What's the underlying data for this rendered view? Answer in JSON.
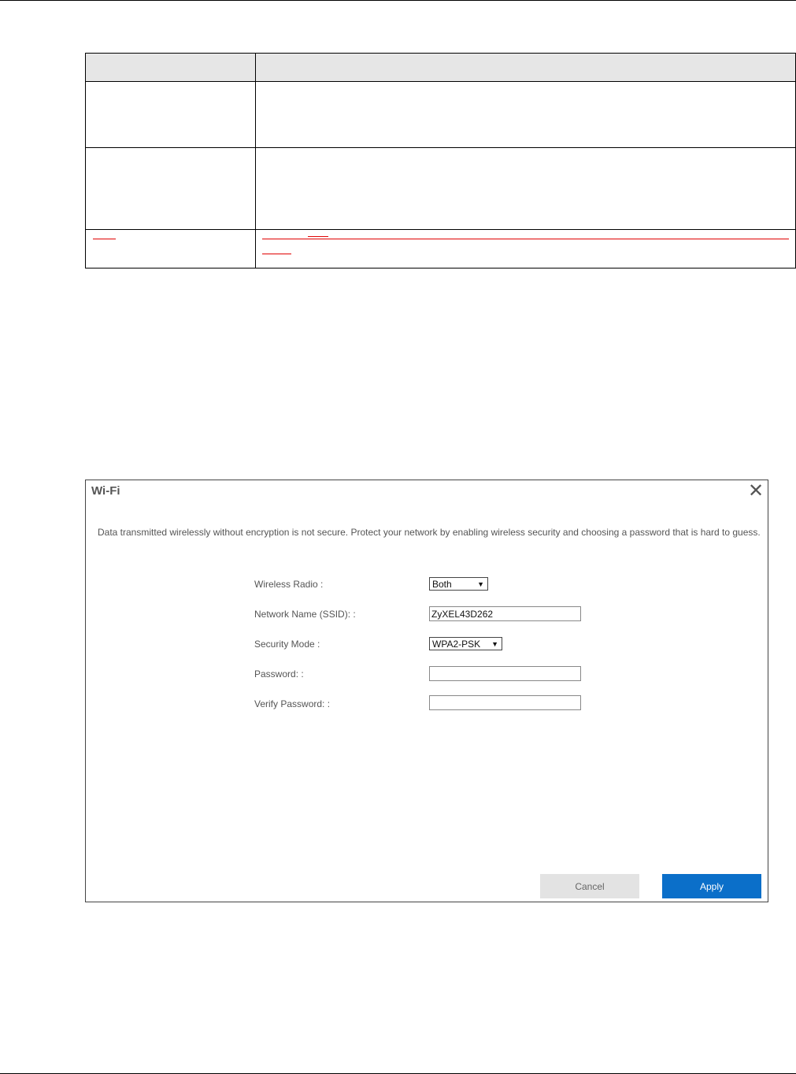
{
  "dialog": {
    "title": "Wi-Fi",
    "message": "Data transmitted wirelessly without encryption is not secure. Protect your network by enabling wireless security and choosing a password that is hard to guess.",
    "wireless_radio_label": "Wireless Radio :",
    "wireless_radio_value": "Both",
    "ssid_label": "Network Name (SSID): :",
    "ssid_value": "ZyXEL43D262",
    "security_mode_label": "Security Mode :",
    "security_mode_value": "WPA2-PSK",
    "password_label": "Password: :",
    "password_value": "",
    "verify_password_label": "Verify Password: :",
    "verify_password_value": "",
    "cancel_label": "Cancel",
    "apply_label": "Apply"
  },
  "colors": {
    "apply_button": "#0b6fc9",
    "cancel_button": "#e3e3e3",
    "table_header": "#e6e6e6",
    "markup_red": "#e00000"
  }
}
